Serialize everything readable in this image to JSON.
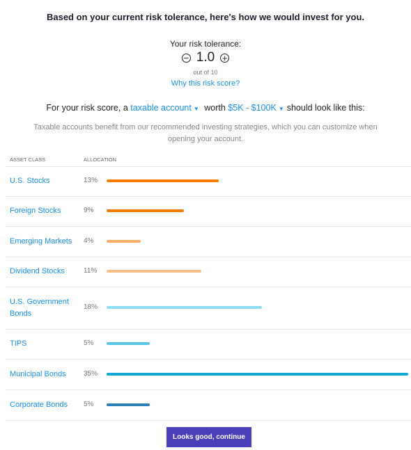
{
  "title": "Based on your current risk tolerance, here's how we would invest for you.",
  "risk": {
    "label": "Your risk tolerance:",
    "score": "1.0",
    "out_of": "out of 10",
    "why_link": "Why this risk score?",
    "decrease_icon": "minus-circle-icon",
    "increase_icon": "plus-circle-icon"
  },
  "sentence": {
    "prefix": "For your risk score, a",
    "account_type": "taxable account",
    "middle": "worth",
    "amount": "$5K - $100K",
    "suffix": "should look like this:"
  },
  "description": "Taxable accounts benefit from our recommended investing strategies, which you can customize when opening your account.",
  "table": {
    "headers": [
      "ASSET CLASS",
      "ALLOCATION"
    ],
    "rows": [
      {
        "name": "U.S. Stocks",
        "pct": "13%",
        "value": 13,
        "color": "#f57c00"
      },
      {
        "name": "Foreign Stocks",
        "pct": "9%",
        "value": 9,
        "color": "#f57c00"
      },
      {
        "name": "Emerging Markets",
        "pct": "4%",
        "value": 4,
        "color": "#f8ad66"
      },
      {
        "name": "Dividend Stocks",
        "pct": "11%",
        "value": 11,
        "color": "#fbbf86"
      },
      {
        "name": "U.S. Government Bonds",
        "pct": "18%",
        "value": 18,
        "color": "#8bdff2"
      },
      {
        "name": "TIPS",
        "pct": "5%",
        "value": 5,
        "color": "#5bc6e0"
      },
      {
        "name": "Municipal Bonds",
        "pct": "35%",
        "value": 35,
        "color": "#13a4d6"
      },
      {
        "name": "Corporate Bonds",
        "pct": "5%",
        "value": 5,
        "color": "#2a7fb5"
      }
    ]
  },
  "continue_button": "Looks good, continue"
}
